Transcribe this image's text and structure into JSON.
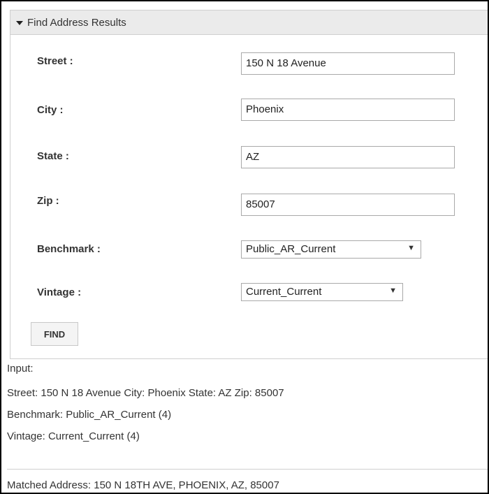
{
  "panel": {
    "title": "Find Address Results"
  },
  "form": {
    "street": {
      "label": "Street :",
      "value": "150 N 18 Avenue"
    },
    "city": {
      "label": "City :",
      "value": "Phoenix"
    },
    "state": {
      "label": "State :",
      "value": "AZ"
    },
    "zip": {
      "label": "Zip :",
      "value": "85007"
    },
    "benchmark": {
      "label": "Benchmark :",
      "value": "Public_AR_Current"
    },
    "vintage": {
      "label": "Vintage :",
      "value": "Current_Current"
    },
    "find_label": "FIND"
  },
  "results": {
    "input_heading": "Input:",
    "input_line": "Street: 150 N 18 Avenue City: Phoenix State: AZ Zip: 85007",
    "benchmark_line": "Benchmark: Public_AR_Current (4)",
    "vintage_line": "Vintage: Current_Current (4)",
    "matched_address": "Matched Address: 150 N 18TH AVE, PHOENIX, AZ, 85007"
  },
  "icons": {
    "collapse": "caret-down-icon",
    "dropdown": "chevron-down-icon"
  }
}
